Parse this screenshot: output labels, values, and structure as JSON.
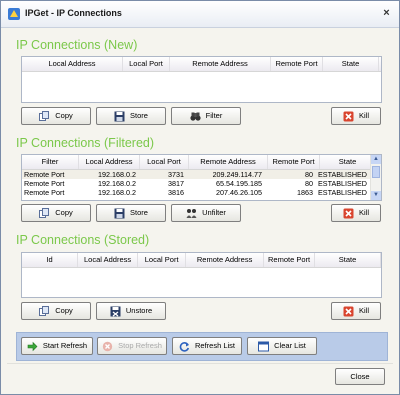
{
  "window": {
    "title": "IPGet - IP Connections",
    "close_glyph": "×"
  },
  "sections": {
    "new": {
      "title": "IP Connections (New)",
      "columns": [
        "Local Address",
        "Local Port",
        "Remote Address",
        "Remote Port",
        "State"
      ],
      "rows": [],
      "buttons": {
        "copy": "Copy",
        "store": "Store",
        "filter": "Filter",
        "kill": "Kill"
      }
    },
    "filtered": {
      "title": "IP Connections (Filtered)",
      "columns": [
        "Filter",
        "Local Address",
        "Local Port",
        "Remote Address",
        "Remote Port",
        "State"
      ],
      "rows": [
        [
          "Remote Port",
          "192.168.0.2",
          "3731",
          "209.249.114.77",
          "80",
          "ESTABLISHED"
        ],
        [
          "Remote Port",
          "192.168.0.2",
          "3817",
          "65.54.195.185",
          "80",
          "ESTABLISHED"
        ],
        [
          "Remote Port",
          "192.168.0.2",
          "3816",
          "207.46.26.105",
          "1863",
          "ESTABLISHED"
        ]
      ],
      "buttons": {
        "copy": "Copy",
        "store": "Store",
        "unfilter": "Unfilter",
        "kill": "Kill"
      }
    },
    "stored": {
      "title": "IP Connections (Stored)",
      "columns": [
        "Id",
        "Local Address",
        "Local Port",
        "Remote Address",
        "Remote Port",
        "State"
      ],
      "rows": [],
      "buttons": {
        "copy": "Copy",
        "unstore": "Unstore",
        "kill": "Kill"
      }
    }
  },
  "toolbar": {
    "start_refresh": "Start Refresh",
    "stop_refresh": "Stop Refresh",
    "refresh_list": "Refresh List",
    "clear_list": "Clear List"
  },
  "close_button": "Close",
  "colors": {
    "section_title": "#7bc84a",
    "panel": "#b9cbe8",
    "kill_icon": "#d9452f"
  }
}
